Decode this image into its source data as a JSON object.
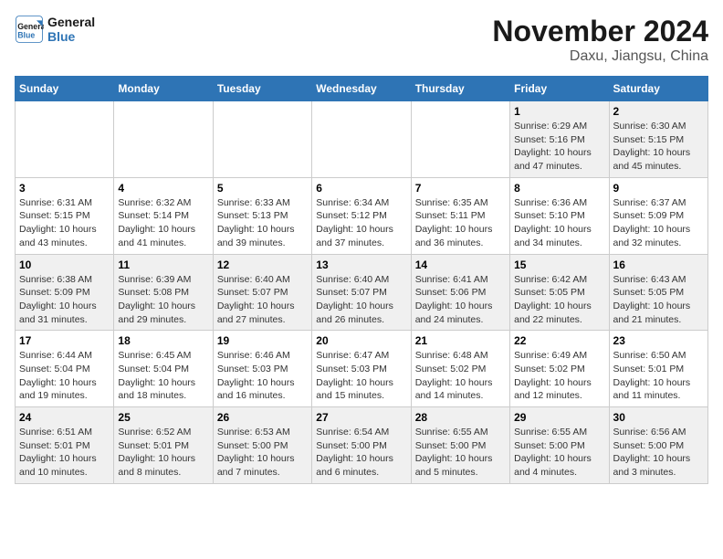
{
  "header": {
    "logo_line1": "General",
    "logo_line2": "Blue",
    "title": "November 2024",
    "subtitle": "Daxu, Jiangsu, China"
  },
  "weekdays": [
    "Sunday",
    "Monday",
    "Tuesday",
    "Wednesday",
    "Thursday",
    "Friday",
    "Saturday"
  ],
  "weeks": [
    [
      {
        "day": "",
        "info": ""
      },
      {
        "day": "",
        "info": ""
      },
      {
        "day": "",
        "info": ""
      },
      {
        "day": "",
        "info": ""
      },
      {
        "day": "",
        "info": ""
      },
      {
        "day": "1",
        "info": "Sunrise: 6:29 AM\nSunset: 5:16 PM\nDaylight: 10 hours and 47 minutes."
      },
      {
        "day": "2",
        "info": "Sunrise: 6:30 AM\nSunset: 5:15 PM\nDaylight: 10 hours and 45 minutes."
      }
    ],
    [
      {
        "day": "3",
        "info": "Sunrise: 6:31 AM\nSunset: 5:15 PM\nDaylight: 10 hours and 43 minutes."
      },
      {
        "day": "4",
        "info": "Sunrise: 6:32 AM\nSunset: 5:14 PM\nDaylight: 10 hours and 41 minutes."
      },
      {
        "day": "5",
        "info": "Sunrise: 6:33 AM\nSunset: 5:13 PM\nDaylight: 10 hours and 39 minutes."
      },
      {
        "day": "6",
        "info": "Sunrise: 6:34 AM\nSunset: 5:12 PM\nDaylight: 10 hours and 37 minutes."
      },
      {
        "day": "7",
        "info": "Sunrise: 6:35 AM\nSunset: 5:11 PM\nDaylight: 10 hours and 36 minutes."
      },
      {
        "day": "8",
        "info": "Sunrise: 6:36 AM\nSunset: 5:10 PM\nDaylight: 10 hours and 34 minutes."
      },
      {
        "day": "9",
        "info": "Sunrise: 6:37 AM\nSunset: 5:09 PM\nDaylight: 10 hours and 32 minutes."
      }
    ],
    [
      {
        "day": "10",
        "info": "Sunrise: 6:38 AM\nSunset: 5:09 PM\nDaylight: 10 hours and 31 minutes."
      },
      {
        "day": "11",
        "info": "Sunrise: 6:39 AM\nSunset: 5:08 PM\nDaylight: 10 hours and 29 minutes."
      },
      {
        "day": "12",
        "info": "Sunrise: 6:40 AM\nSunset: 5:07 PM\nDaylight: 10 hours and 27 minutes."
      },
      {
        "day": "13",
        "info": "Sunrise: 6:40 AM\nSunset: 5:07 PM\nDaylight: 10 hours and 26 minutes."
      },
      {
        "day": "14",
        "info": "Sunrise: 6:41 AM\nSunset: 5:06 PM\nDaylight: 10 hours and 24 minutes."
      },
      {
        "day": "15",
        "info": "Sunrise: 6:42 AM\nSunset: 5:05 PM\nDaylight: 10 hours and 22 minutes."
      },
      {
        "day": "16",
        "info": "Sunrise: 6:43 AM\nSunset: 5:05 PM\nDaylight: 10 hours and 21 minutes."
      }
    ],
    [
      {
        "day": "17",
        "info": "Sunrise: 6:44 AM\nSunset: 5:04 PM\nDaylight: 10 hours and 19 minutes."
      },
      {
        "day": "18",
        "info": "Sunrise: 6:45 AM\nSunset: 5:04 PM\nDaylight: 10 hours and 18 minutes."
      },
      {
        "day": "19",
        "info": "Sunrise: 6:46 AM\nSunset: 5:03 PM\nDaylight: 10 hours and 16 minutes."
      },
      {
        "day": "20",
        "info": "Sunrise: 6:47 AM\nSunset: 5:03 PM\nDaylight: 10 hours and 15 minutes."
      },
      {
        "day": "21",
        "info": "Sunrise: 6:48 AM\nSunset: 5:02 PM\nDaylight: 10 hours and 14 minutes."
      },
      {
        "day": "22",
        "info": "Sunrise: 6:49 AM\nSunset: 5:02 PM\nDaylight: 10 hours and 12 minutes."
      },
      {
        "day": "23",
        "info": "Sunrise: 6:50 AM\nSunset: 5:01 PM\nDaylight: 10 hours and 11 minutes."
      }
    ],
    [
      {
        "day": "24",
        "info": "Sunrise: 6:51 AM\nSunset: 5:01 PM\nDaylight: 10 hours and 10 minutes."
      },
      {
        "day": "25",
        "info": "Sunrise: 6:52 AM\nSunset: 5:01 PM\nDaylight: 10 hours and 8 minutes."
      },
      {
        "day": "26",
        "info": "Sunrise: 6:53 AM\nSunset: 5:00 PM\nDaylight: 10 hours and 7 minutes."
      },
      {
        "day": "27",
        "info": "Sunrise: 6:54 AM\nSunset: 5:00 PM\nDaylight: 10 hours and 6 minutes."
      },
      {
        "day": "28",
        "info": "Sunrise: 6:55 AM\nSunset: 5:00 PM\nDaylight: 10 hours and 5 minutes."
      },
      {
        "day": "29",
        "info": "Sunrise: 6:55 AM\nSunset: 5:00 PM\nDaylight: 10 hours and 4 minutes."
      },
      {
        "day": "30",
        "info": "Sunrise: 6:56 AM\nSunset: 5:00 PM\nDaylight: 10 hours and 3 minutes."
      }
    ]
  ]
}
